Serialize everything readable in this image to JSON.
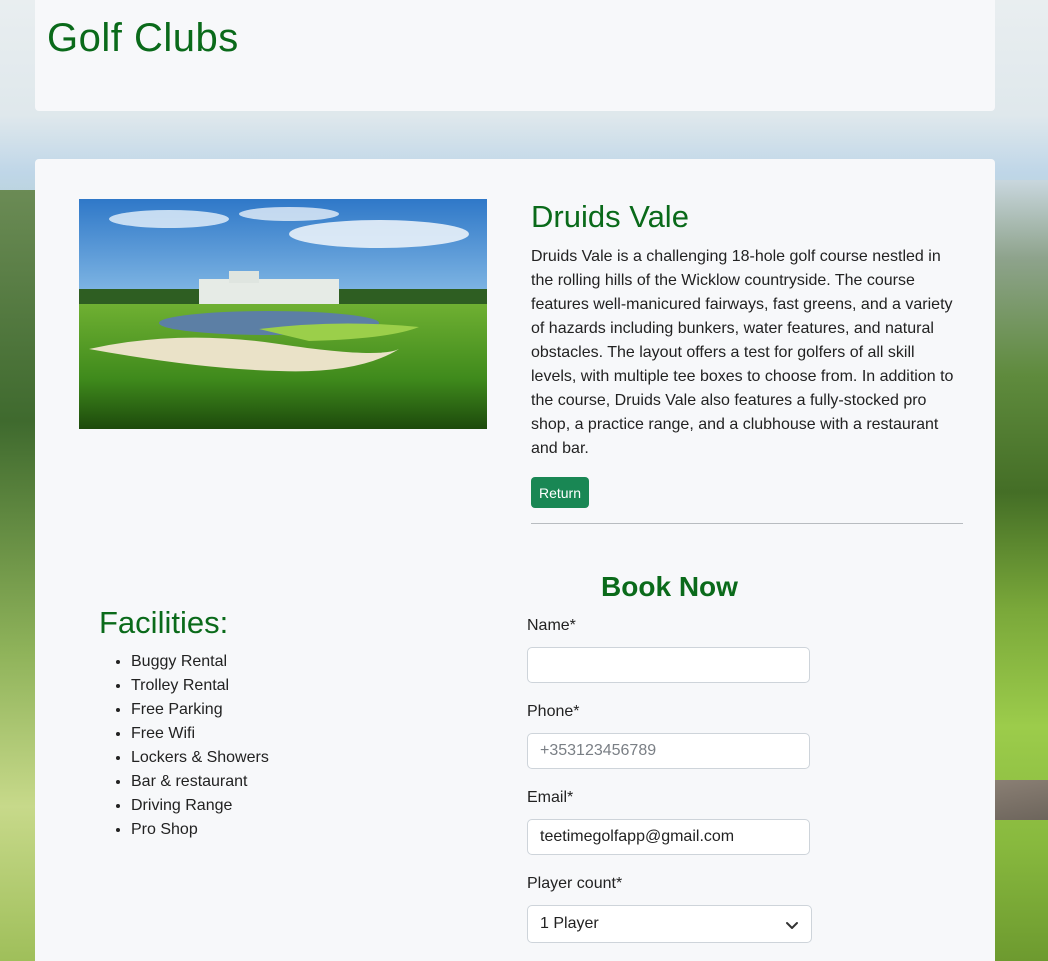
{
  "header": {
    "title": "Golf Clubs"
  },
  "course": {
    "name": "Druids Vale",
    "description": "Druids Vale is a challenging 18-hole golf course nestled in the rolling hills of the Wicklow countryside. The course features well-manicured fairways, fast greens, and a variety of hazards including bunkers, water features, and natural obstacles. The layout offers a test for golfers of all skill levels, with multiple tee boxes to choose from. In addition to the course, Druids Vale also features a fully-stocked pro shop, a practice range, and a clubhouse with a restaurant and bar.",
    "return_label": "Return"
  },
  "facilities": {
    "title": "Facilities:",
    "items": [
      "Buggy Rental",
      "Trolley Rental",
      "Free Parking",
      "Free Wifi",
      "Lockers & Showers",
      "Bar & restaurant",
      "Driving Range",
      "Pro Shop"
    ]
  },
  "booking": {
    "title": "Book Now",
    "name_label": "Name*",
    "name_value": "",
    "phone_label": "Phone*",
    "phone_placeholder": "+353123456789",
    "email_label": "Email*",
    "email_value": "teetimegolfapp@gmail.com",
    "players_label": "Player count*",
    "players_selected": "1 Player"
  },
  "colors": {
    "accent": "#0a6a1a",
    "button": "#198754"
  }
}
